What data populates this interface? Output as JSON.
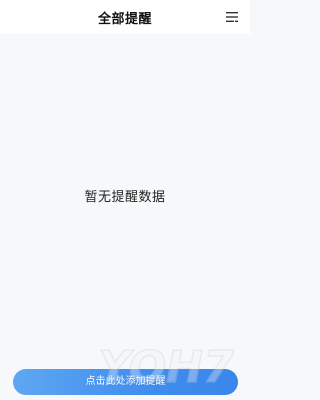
{
  "header": {
    "title": "全部提醒",
    "menu_icon": "menu-icon"
  },
  "main": {
    "empty_message": "暂无提醒数据"
  },
  "footer": {
    "add_button_label": "点击此处添加提醒"
  },
  "watermark": {
    "text": "YOH7"
  },
  "colors": {
    "background": "#f7f8fa",
    "header_background": "#ffffff",
    "button_gradient_start": "#5fa7f2",
    "button_gradient_end": "#3b86ea",
    "button_text": "#ffffff"
  }
}
